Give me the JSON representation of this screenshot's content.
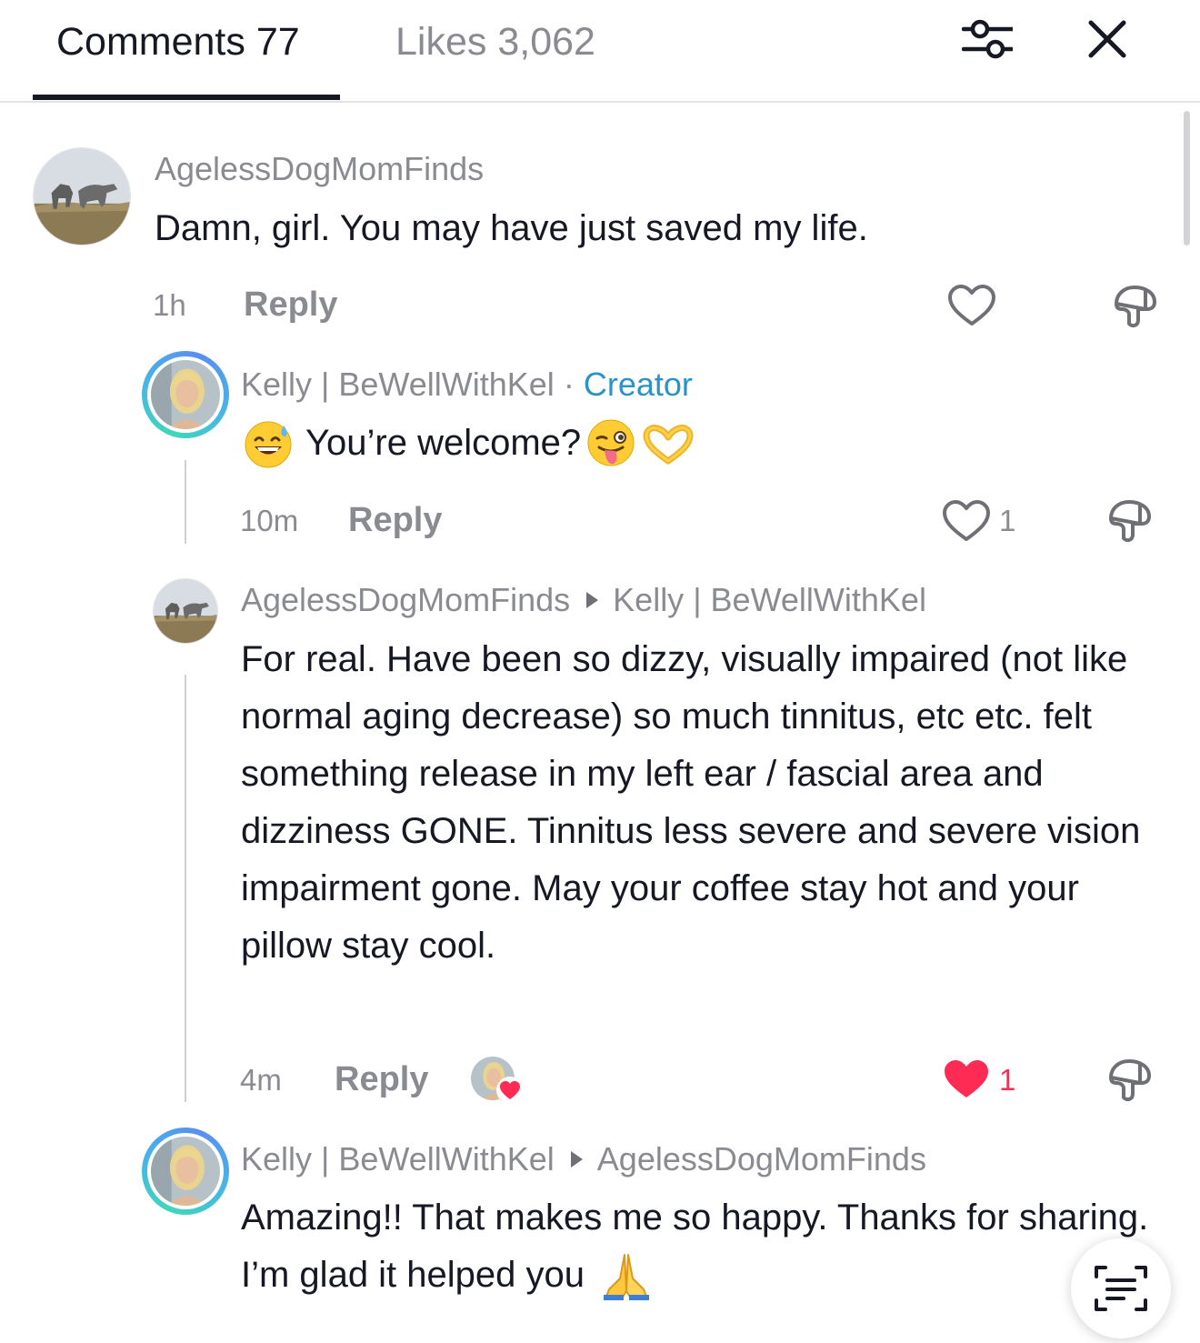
{
  "header": {
    "tab_comments": "Comments 77",
    "tab_likes": "Likes 3,062",
    "filter_icon": "sliders-icon",
    "close_icon": "close-icon"
  },
  "comments": [
    {
      "username": "AgelessDogMomFinds",
      "text": "Damn, girl. You may have just saved my life.",
      "time": "1h",
      "reply_label": "Reply",
      "likes": ""
    },
    {
      "username": "Kelly | BeWellWithKel",
      "separator": "·",
      "badge": "Creator",
      "text": "You’re welcome?",
      "emojis": [
        "grinning-sweat-emoji",
        "winking-tongue-emoji",
        "heart-hands-emoji"
      ],
      "time": "10m",
      "reply_label": "Reply",
      "likes": "1"
    },
    {
      "username": "AgelessDogMomFinds",
      "reply_to": "Kelly | BeWellWithKel",
      "text": "For real. Have been so dizzy, visually impaired (not like normal aging decrease) so much tinnitus, etc etc. felt something release in my left ear / fascial area and dizziness GONE. Tinnitus less severe and severe vision impairment gone. May your coffee stay hot and your pillow stay cool.",
      "time": "4m",
      "reply_label": "Reply",
      "likes": "1",
      "liked_by_creator": true
    },
    {
      "username": "Kelly | BeWellWithKel",
      "reply_to": "AgelessDogMomFinds",
      "text": "Amazing!! That makes me so happy. Thanks for sharing. I’m glad it helped you",
      "emojis": [
        "folded-hands-emoji"
      ]
    }
  ],
  "colors": {
    "text": "#161823",
    "muted": "#8a8b91",
    "creator": "#2b93c6",
    "liked": "#fe2c55"
  }
}
